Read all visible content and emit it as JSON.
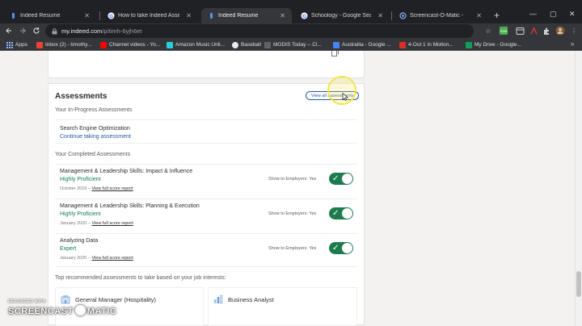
{
  "browser": {
    "tabs": [
      {
        "title": "Indeed Resume",
        "favicon": "indeed-icon",
        "active": false
      },
      {
        "title": "How to take Indeed Assessme",
        "favicon": "google-icon",
        "active": false
      },
      {
        "title": "Indeed Resume",
        "favicon": "indeed-icon",
        "active": true
      },
      {
        "title": "Schoology - Google Search",
        "favicon": "google-icon",
        "active": false
      },
      {
        "title": "Screencast-O-Matic -",
        "favicon": "screencast-icon",
        "active": false
      }
    ],
    "window_controls": {
      "minimize": "—",
      "maximize": "▢",
      "close": "✕"
    },
    "url_host": "my.indeed.com",
    "url_path": "/p/timh-6yjh6et",
    "bookmarks": [
      {
        "label": "Apps",
        "color": "#8ab4f8"
      },
      {
        "label": "Inbox (2) - timothy...",
        "color": "#ea4335"
      },
      {
        "label": "Channel videos - Yo...",
        "color": "#ff0000"
      },
      {
        "label": "Amazon Music Unli...",
        "color": "#25d1da"
      },
      {
        "label": "Baseball",
        "color": "#e8eaed"
      },
      {
        "label": "MODIS Today -- Cl...",
        "color": "#5f6368"
      },
      {
        "label": "Austrailia - Google ...",
        "color": "#4285f4"
      },
      {
        "label": "4-Out 1 In Motion...",
        "color": "#d93025"
      },
      {
        "label": "My Drive - Google...",
        "color": "#0f9d58"
      }
    ]
  },
  "assessments": {
    "title": "Assessments",
    "view_all_label": "View all assessments",
    "in_progress_heading": "Your In-Progress Assessments",
    "in_progress": {
      "name": "Search Engine Optimization",
      "action": "Continue taking assessment"
    },
    "completed_heading": "Your Completed Assessments",
    "completed": [
      {
        "name": "Management & Leadership Skills: Impact & Influence",
        "score": "Highly Proficient",
        "date": "October 2019",
        "separator": "–",
        "report_link": "View full score report",
        "show_label": "Show to Employers: Yes"
      },
      {
        "name": "Management & Leadership Skills: Planning & Execution",
        "score": "Highly Proficient",
        "date": "January 2020",
        "separator": "–",
        "report_link": "View full score report",
        "show_label": "Show to Employers: Yes"
      },
      {
        "name": "Analyzing Data",
        "score": "Expert",
        "date": "January 2020",
        "separator": "–",
        "report_link": "View full score report",
        "show_label": "Show to Employers: Yes"
      }
    ],
    "recommended_heading": "Top recommended assessments to take based on your job interests:",
    "recommended": [
      {
        "label": "General Manager (Hospitality)"
      },
      {
        "label": "Business Analyst"
      }
    ]
  },
  "watermark": {
    "recorded_with": "RECORDED WITH",
    "brand_left": "SCREENCAST",
    "brand_right": "MATIC"
  }
}
